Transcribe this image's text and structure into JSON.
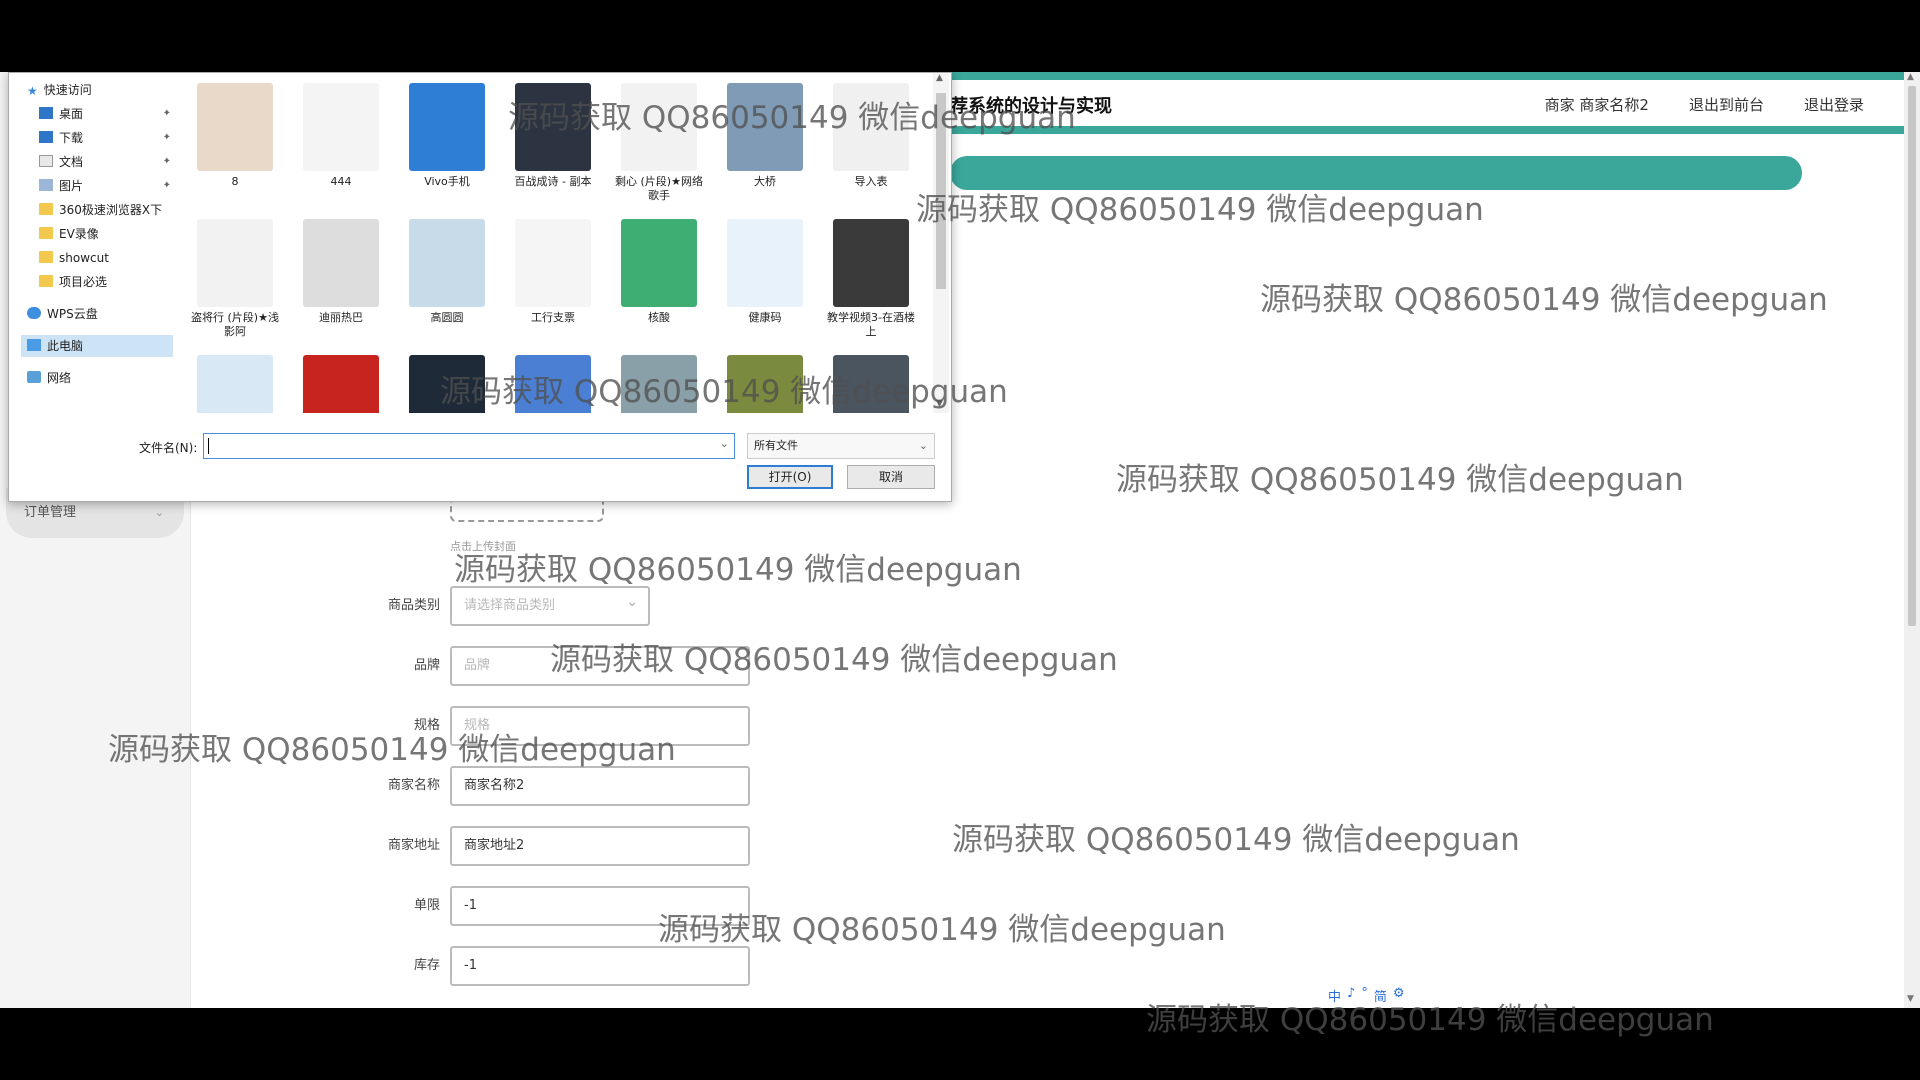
{
  "header": {
    "title": "荐系统的设计与实现",
    "nav": [
      "商家 商家名称2",
      "退出到前台",
      "退出登录"
    ]
  },
  "sidebar": {
    "item_label": "订单管理"
  },
  "upload_hint": "点击上传封面",
  "form": {
    "rows": [
      {
        "label": "商品类别",
        "value": "请选择商品类别",
        "placeholder": true,
        "type": "select"
      },
      {
        "label": "品牌",
        "value": "品牌",
        "placeholder": true,
        "type": "input"
      },
      {
        "label": "规格",
        "value": "规格",
        "placeholder": true,
        "type": "input"
      },
      {
        "label": "商家名称",
        "value": "商家名称2",
        "placeholder": false,
        "type": "input"
      },
      {
        "label": "商家地址",
        "value": "商家地址2",
        "placeholder": false,
        "type": "input"
      },
      {
        "label": "单限",
        "value": "-1",
        "placeholder": false,
        "type": "input"
      },
      {
        "label": "库存",
        "value": "-1",
        "placeholder": false,
        "type": "input"
      }
    ]
  },
  "dialog": {
    "nav": [
      {
        "label": "快速访问",
        "icon": "star-icon",
        "pinned": false
      },
      {
        "label": "桌面",
        "icon": "desktop-icon",
        "pinned": true
      },
      {
        "label": "下载",
        "icon": "download-icon",
        "pinned": true
      },
      {
        "label": "文档",
        "icon": "document-icon",
        "pinned": true
      },
      {
        "label": "图片",
        "icon": "pictures-icon",
        "pinned": true
      },
      {
        "label": "360极速浏览器X下",
        "icon": "folder-icon",
        "pinned": false
      },
      {
        "label": "EV录像",
        "icon": "folder-icon",
        "pinned": false
      },
      {
        "label": "showcut",
        "icon": "folder-icon",
        "pinned": false
      },
      {
        "label": "项目必选",
        "icon": "folder-icon",
        "pinned": false
      },
      {
        "label": "WPS云盘",
        "icon": "cloud-icon",
        "pinned": false
      },
      {
        "label": "此电脑",
        "icon": "computer-icon",
        "pinned": false
      },
      {
        "label": "网络",
        "icon": "network-icon",
        "pinned": false
      }
    ],
    "files": [
      {
        "name": "8",
        "color": "#e9d9c9"
      },
      {
        "name": "444",
        "color": "#f4f4f4"
      },
      {
        "name": "Vivo手机",
        "color": "#2f7ed6"
      },
      {
        "name": "百战成诗 - 副本",
        "color": "#2b3440"
      },
      {
        "name": "剩心 (片段)★网络歌手",
        "color": "#f2f2f2"
      },
      {
        "name": "大桥",
        "color": "#7f9bb5"
      },
      {
        "name": "导入表",
        "color": "#f0f0f0"
      },
      {
        "name": "盗将行 (片段)★浅影阿",
        "color": "#f2f2f2"
      },
      {
        "name": "迪丽热巴",
        "color": "#dddddd"
      },
      {
        "name": "高圆圆",
        "color": "#c7dbe8"
      },
      {
        "name": "工行支票",
        "color": "#f5f5f5"
      },
      {
        "name": "核酸",
        "color": "#3fae72"
      },
      {
        "name": "健康码",
        "color": "#e8f2fb"
      },
      {
        "name": "教学视频3-在酒楼上",
        "color": "#3a3a3a"
      },
      {
        "name": "",
        "color": "#d8e8f4"
      },
      {
        "name": "",
        "color": "#c8241f"
      },
      {
        "name": "",
        "color": "#1f2a38"
      },
      {
        "name": "",
        "color": "#4a7fd4"
      },
      {
        "name": "",
        "color": "#8aa0a8"
      },
      {
        "name": "",
        "color": "#7a8a3e"
      },
      {
        "name": "",
        "color": "#4a5560"
      },
      {
        "name": "",
        "color": "#eeeeee"
      }
    ],
    "filename_label": "文件名(N):",
    "filename_value": "",
    "filetype": "所有文件",
    "open_button": "打开(O)",
    "cancel_button": "取消"
  },
  "watermark": "源码获取 QQ86050149 微信deepguan",
  "ime": [
    "中",
    "♪",
    "°",
    "简",
    "⚙"
  ],
  "colors": {
    "accent": "#3aa79a",
    "dialog_focus": "#2d7dd2"
  }
}
